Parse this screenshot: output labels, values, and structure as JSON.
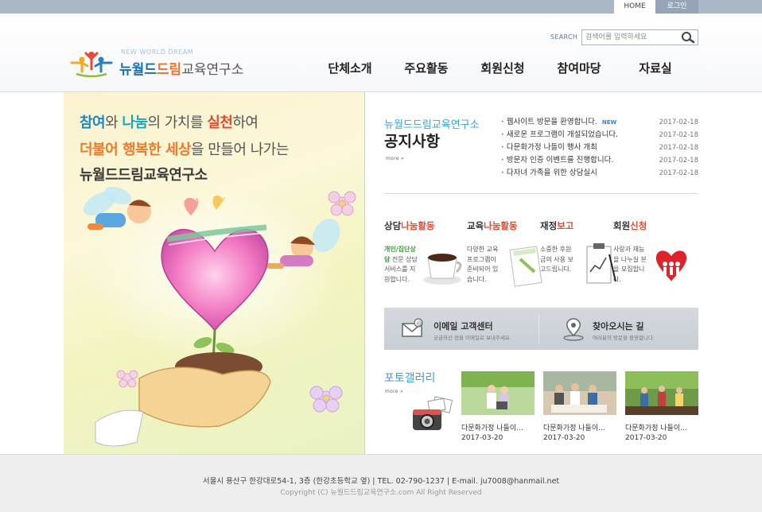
{
  "topbar": {
    "home": "HOME",
    "login": "로그인"
  },
  "header": {
    "logo_sub": "NEW WORLD DREAM",
    "logo_part1": "뉴월드",
    "logo_part2": "드림",
    "logo_part3": "교육연구소",
    "search_label": "SEARCH",
    "search_placeholder": "검색어를 입력하세요",
    "nav": [
      "단체소개",
      "주요활동",
      "회원신청",
      "참여마당",
      "자료실"
    ]
  },
  "hero": {
    "line1": [
      "참여",
      "와 ",
      "나눔",
      "의 가치를 ",
      "실천",
      "하여"
    ],
    "line2": [
      "더불어 행복한 세상",
      "을 만들어 나가는"
    ],
    "line3": "뉴월드드림교육연구소"
  },
  "notice": {
    "org_name": "뉴월드드림교육연구소",
    "title": "공지사항",
    "more": "more »",
    "new_badge": "NEW",
    "items": [
      {
        "title": "웹사이트 방문을 환영합니다.",
        "date": "2017-02-18"
      },
      {
        "title": "새로운 프로그램이 개설되었습니다.",
        "date": "2017-02-18"
      },
      {
        "title": "다문화가정 나들이 행사 개최",
        "date": "2017-02-18"
      },
      {
        "title": "방문자 인증 이벤트를 진행합니다.",
        "date": "2017-02-18"
      },
      {
        "title": "다자녀 가족을 위한 상담실시",
        "date": "2017-02-18"
      }
    ]
  },
  "cards": [
    {
      "title_a": "상담",
      "title_b": "나눔활동",
      "desc_first": "개인/집단상담",
      "desc": "전문 상담 서비스를 지원합니다."
    },
    {
      "title_a": "교육",
      "title_b": "나눔활동",
      "desc_first": "",
      "desc": "다양한 교육 프로그램이 준비되어 있습니다."
    },
    {
      "title_a": "재정",
      "title_b": "보고",
      "desc_first": "",
      "desc": "소중한 후원금의 사용 보고드립니다."
    },
    {
      "title_a": "회원",
      "title_b": "신청",
      "desc_first": "",
      "desc": "사랑과 재능을 나누실 분을 모집합니다."
    }
  ],
  "banner": {
    "email_title": "이메일 고객센터",
    "email_sub": "궁금하신 점을 이메일로 보내주세요.",
    "map_title": "찾아오시는 길",
    "map_sub": "여러분의 방문을 환영합니다."
  },
  "gallery": {
    "title": "포토갤러리",
    "more": "more »",
    "items": [
      {
        "caption": "다문화가정 나들이...",
        "date": "2017-03-20"
      },
      {
        "caption": "다문화가정 나들이...",
        "date": "2017-03-20"
      },
      {
        "caption": "다문화가정 나들이...",
        "date": "2017-03-20"
      }
    ]
  },
  "footer": {
    "address": "서울시 용산구 한강대로54-1, 3층 (한강초등학교 옆)  |  TEL. 02-790-1237  |  E-mail. ju7008@hanmail.net",
    "copyright": "Copyright (C) 뉴월드드림교육연구소.com All Right Reserved"
  },
  "colors": {
    "brand_blue": "#1c6dab",
    "brand_orange": "#e8742d",
    "accent_red": "#e24a2f",
    "title_blue": "#3aa0d8",
    "topbar": "#a9b6c6"
  }
}
